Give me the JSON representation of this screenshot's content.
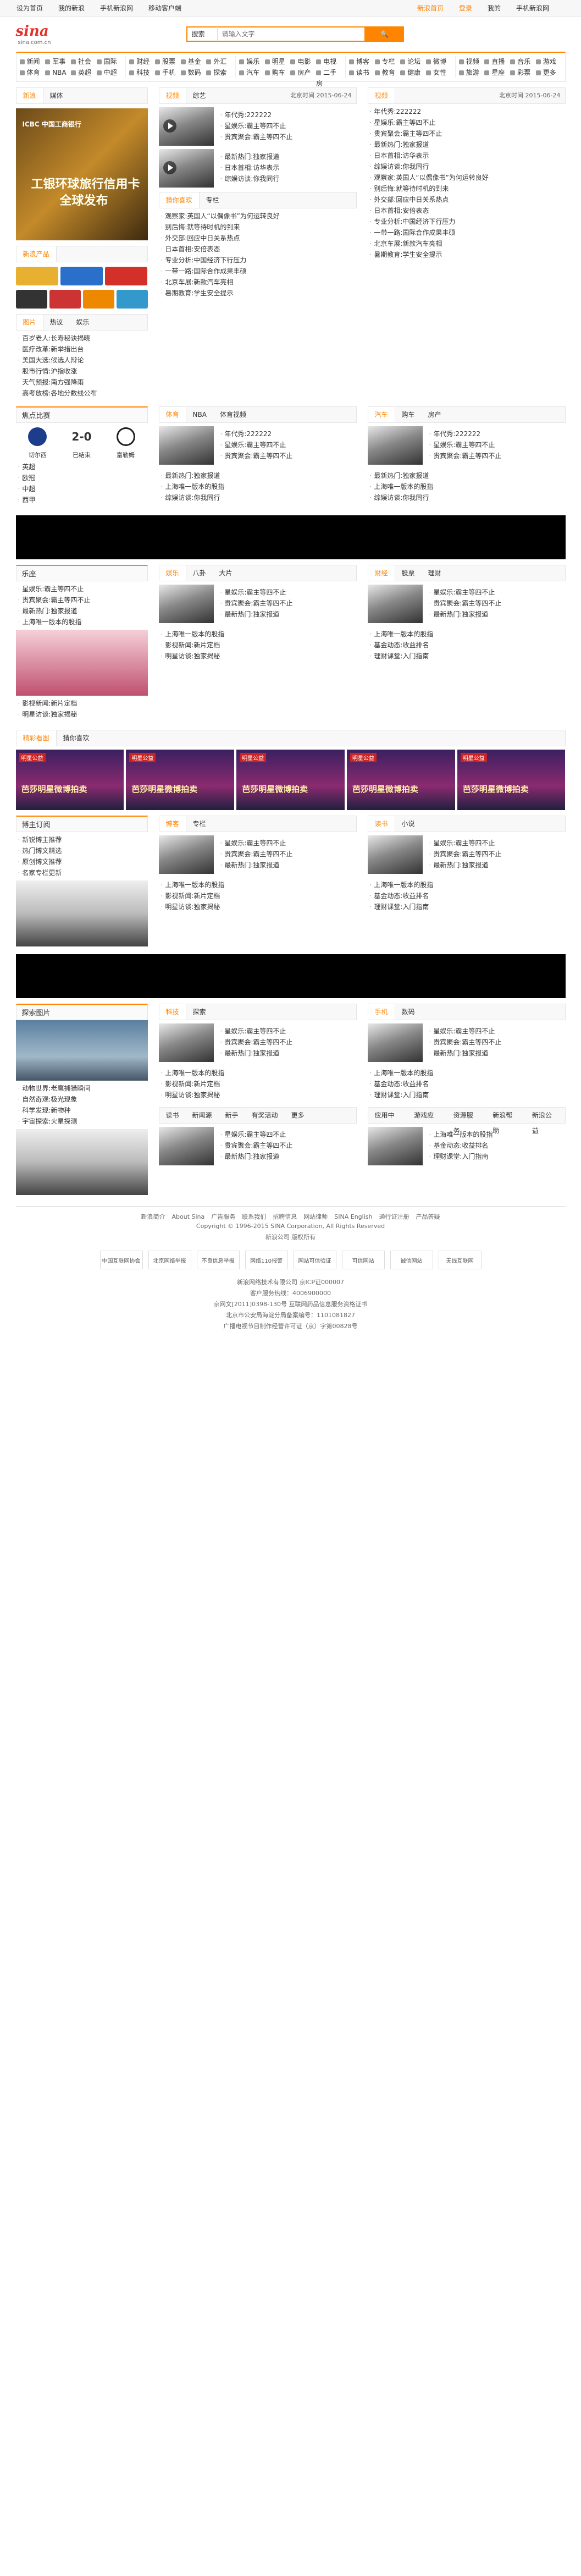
{
  "topbar": {
    "links_left": [
      "设为首页",
      "我的新浪",
      "手机新浪网",
      "移动客户端"
    ],
    "links_right": [
      "新浪首页",
      "登录",
      "我的",
      "手机新浪网"
    ]
  },
  "header": {
    "logo_text": "sina",
    "logo_domain": "sina.com.cn",
    "search_select": "搜索",
    "search_placeholder": "请输入文字",
    "search_button": "搜"
  },
  "nav": [
    [
      "新闻",
      "军事",
      "社会",
      "国际",
      "体育",
      "NBA",
      "英超",
      "中超"
    ],
    [
      "财经",
      "股票",
      "基金",
      "外汇",
      "科技",
      "手机",
      "数码",
      "探索"
    ],
    [
      "娱乐",
      "明星",
      "电影",
      "电视",
      "汽车",
      "购车",
      "房产",
      "二手房"
    ],
    [
      "博客",
      "专栏",
      "论坛",
      "微博",
      "读书",
      "教育",
      "健康",
      "女性"
    ],
    [
      "视频",
      "直播",
      "音乐",
      "游戏",
      "旅游",
      "星座",
      "彩票",
      "更多"
    ]
  ],
  "block1": {
    "left_tabs": [
      "新浪",
      "媒体"
    ],
    "left_title": "北京时间 2015-06-24",
    "mid_tabs": [
      "视频",
      "综艺"
    ],
    "mid_time": "北京时间 2015-06-24",
    "right_tabs": [
      "视频"
    ],
    "right_time": "北京时间 2015-06-24",
    "ad_title": "工银环球旅行信用卡",
    "ad_sub": "全球发布",
    "mid_items": [
      "年代秀:222222",
      "星娱乐:霸主等四不止",
      "贵宾聚会:霸主等四不止",
      "最新热门:独家报道",
      "日本首相:访华表示",
      "综娱访谈:你我同行"
    ],
    "right_items": [
      "年代秀:222222",
      "星娱乐:霸主等四不止",
      "贵宾聚会:霸主等四不止",
      "最新热门:独家报道",
      "日本首相:访华表示",
      "综娱访谈:你我同行"
    ]
  },
  "hot": {
    "tabs": [
      "新浪产品"
    ],
    "list": [
      "观察家:英国人“以偶像书”为何运转良好",
      "别后悔:就等待时机的到来",
      "外交部:回应中日关系热点",
      "日本首相:安倍表态",
      "专业分析:中国经济下行压力",
      "一带一路:国际合作成果丰硕",
      "北京车展:新款汽车亮相",
      "暑期教育:学生安全提示"
    ],
    "sub_tabs": [
      "图片",
      "热议",
      "娱乐"
    ],
    "sub_list": [
      "百岁老人:长寿秘诀揭晓",
      "医疗改革:新举措出台",
      "美国大选:候选人辩论",
      "股市行情:沪指收涨",
      "天气预报:南方强降雨",
      "高考放榜:各地分数线公布"
    ]
  },
  "sport": {
    "title": "焦点比赛",
    "home": "切尔西",
    "away": "富勒姆",
    "score": "2-0",
    "status": "已结束",
    "left_list": [
      "英超",
      "欧冠",
      "中超",
      "西甲"
    ],
    "tabs": [
      "体育",
      "NBA",
      "体育视频"
    ],
    "items": [
      "年代秀:222222",
      "星娱乐:霸主等四不止",
      "贵宾聚会:霸主等四不止",
      "最新热门:独家报道",
      "上海唯一版本的股指",
      "综娱访谈:你我同行"
    ]
  },
  "ent": {
    "title": "乐座",
    "tabs": [
      "娱乐",
      "八卦",
      "大片"
    ],
    "items": [
      "星娱乐:霸主等四不止",
      "贵宾聚会:霸主等四不止",
      "最新热门:独家报道",
      "上海唯一版本的股指",
      "影视新闻:新片定档",
      "明星访谈:独家揭秘"
    ]
  },
  "finance": {
    "tabs": [
      "财经",
      "股票",
      "理财"
    ],
    "items": [
      "星娱乐:霸主等四不止",
      "贵宾聚会:霸主等四不止",
      "最新热门:独家报道",
      "上海唯一版本的股指",
      "基金动态:收益排名",
      "理财课堂:入门指南"
    ]
  },
  "banners": {
    "title_tabs": [
      "精彩看图",
      "猜你喜欢"
    ],
    "items": [
      "芭莎明星微博拍卖",
      "芭莎明星微博拍卖",
      "芭莎明星微博拍卖",
      "芭莎明星微博拍卖",
      "芭莎明星微博拍卖"
    ],
    "tag": "明星公益"
  },
  "blog": {
    "title": "博主订阅",
    "tabs_mid": [
      "博客",
      "专栏"
    ],
    "tabs_right": [
      "读书",
      "小说"
    ],
    "left_items": [
      "新锐博主推荐",
      "热门博文精选",
      "原创博文推荐",
      "名家专栏更新"
    ]
  },
  "explore": {
    "title": "探索图片",
    "tabs_mid": [
      "科技",
      "探索"
    ],
    "tabs_right": [
      "手机",
      "数码"
    ],
    "left_items": [
      "动物世界:老鹰捕猎瞬间",
      "自然奇观:极光现象",
      "科学发现:新物种",
      "宇宙探索:火星探测"
    ]
  },
  "bottomlinks": {
    "mid": [
      "读书",
      "新闻源",
      "新手",
      "有奖活动",
      "更多"
    ],
    "right": [
      "应用中心",
      "游戏应用",
      "资源服务",
      "新浪帮助",
      "新浪公益"
    ]
  },
  "footer": {
    "links": [
      "新浪简介",
      "About Sina",
      "广告服务",
      "联系我们",
      "招聘信息",
      "网站律师",
      "SINA English",
      "通行证注册",
      "产品答疑"
    ],
    "copyright": "Copyright © 1996-2015 SINA Corporation, All Rights Reserved",
    "company": "新浪公司 版权所有",
    "badges": [
      "中国互联网协会",
      "北京网络举报",
      "不良信息举报",
      "网络110报警",
      "网站可信验证",
      "可信网站",
      "诚信网站",
      "无线互联网"
    ],
    "lines": [
      "新浪网络技术有限公司 京ICP证000007",
      "客户服务热线：4006900000",
      "京网文[2011]0398-130号 互联网药品信息服务资格证书",
      "北京市公安局海淀分局备案编号：1101081827",
      "广播电视节目制作经营许可证（京）字第00828号"
    ]
  }
}
